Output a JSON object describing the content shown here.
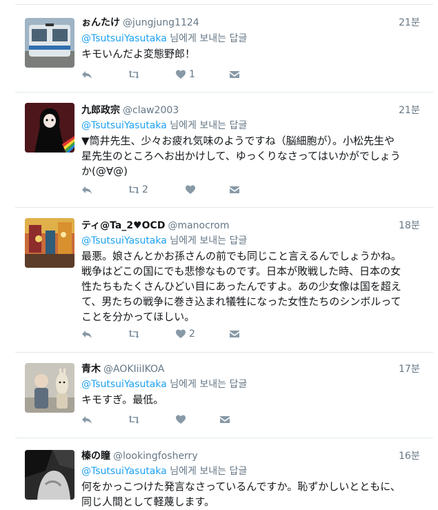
{
  "tweets": [
    {
      "display_name": "ぉんたけ",
      "handle": "@jungjung1124",
      "time": "21분",
      "mention": "@TsutsuiYasutaka",
      "reply_suffix": " 님에게 보내는 답글",
      "lines": [
        "キモいんだよ変態野郎！"
      ],
      "reply_count": "",
      "retweet_count": "",
      "like_count": "1",
      "avatar": "train-photo"
    },
    {
      "display_name": "九郎政宗",
      "handle": "@claw2003",
      "time": "21분",
      "mention": "@TsutsuiYasutaka",
      "reply_suffix": " 님에게 보내는 답글",
      "lines": [
        "▼筒井先生、少々お疲れ気味のようですね（脳細胞が）。小松先生や",
        "星先生のところへお出かけして、ゆっくりなさってはいかがでしょう",
        "か(@∀@)"
      ],
      "reply_count": "",
      "retweet_count": "2",
      "like_count": "",
      "avatar": "dark-figure-illustration"
    },
    {
      "display_name": "ティ@Ta_2♥OCD",
      "handle": "@manocrom",
      "time": "18분",
      "mention": "@TsutsuiYasutaka",
      "reply_suffix": " 님에게 보내는 답글",
      "lines": [
        "最悪。娘さんとかお孫さんの前でも同じこと言えるんでしょうかね。",
        "戦争はどこの国にでも悲惨なものです。日本が敗戦した時、日本の女",
        "性たちもたくさんひどい目にあったんですよ。あの少女像は国を超え",
        "て、男たちの戦争に巻き込まれ犠牲になった女性たちのシンボルって",
        "ことを分かってほしい。"
      ],
      "reply_count": "",
      "retweet_count": "",
      "like_count": "2",
      "avatar": "colorful-street-photo"
    },
    {
      "display_name": "青木",
      "handle": "@AOKIiiIKOA",
      "time": "17분",
      "mention": "@TsutsuiYasutaka",
      "reply_suffix": " 님에게 보내는 답글",
      "lines": [
        "キモすぎ。最低。"
      ],
      "reply_count": "",
      "retweet_count": "",
      "like_count": "",
      "avatar": "character-photo"
    },
    {
      "display_name": "榛の瞳",
      "handle": "@lookingfosherry",
      "time": "16분",
      "mention": "@TsutsuiYasutaka",
      "reply_suffix": " 님에게 보내는 답글",
      "lines": [
        "何をかっこつけた発言なさっているんですか。恥ずかしいとともに、",
        "同じ人間として軽蔑します。"
      ],
      "reply_count": "",
      "retweet_count": "",
      "like_count": "",
      "avatar": "monochrome-photo"
    }
  ],
  "colors": {
    "link": "#1da1f2",
    "secondary_text": "#657786",
    "icon": "#8899a6",
    "separator": "#e1e8ed"
  },
  "icons": [
    "reply-icon",
    "retweet-icon",
    "like-icon",
    "direct-message-icon"
  ]
}
